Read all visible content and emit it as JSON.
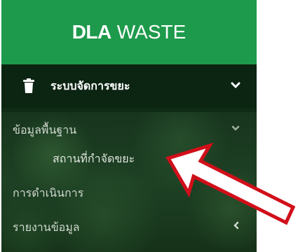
{
  "header": {
    "title_bold": "DLA",
    "title_rest": "WASTE"
  },
  "menu": {
    "main": {
      "label": "ระบบจัดการขยะ",
      "icon": "trash-icon"
    },
    "items": [
      {
        "label": "ข้อมูลพื้นฐาน",
        "chevron": "⌄"
      },
      {
        "label": "สถานที่กำจัดขยะ"
      },
      {
        "label": "การดำเนินการ"
      },
      {
        "label": "รายงานข้อมูล",
        "chevron": "‹"
      }
    ]
  },
  "colors": {
    "header": "#1e9a4c",
    "sidebar": "#0f2b16",
    "arrow": "#d10f1a"
  }
}
